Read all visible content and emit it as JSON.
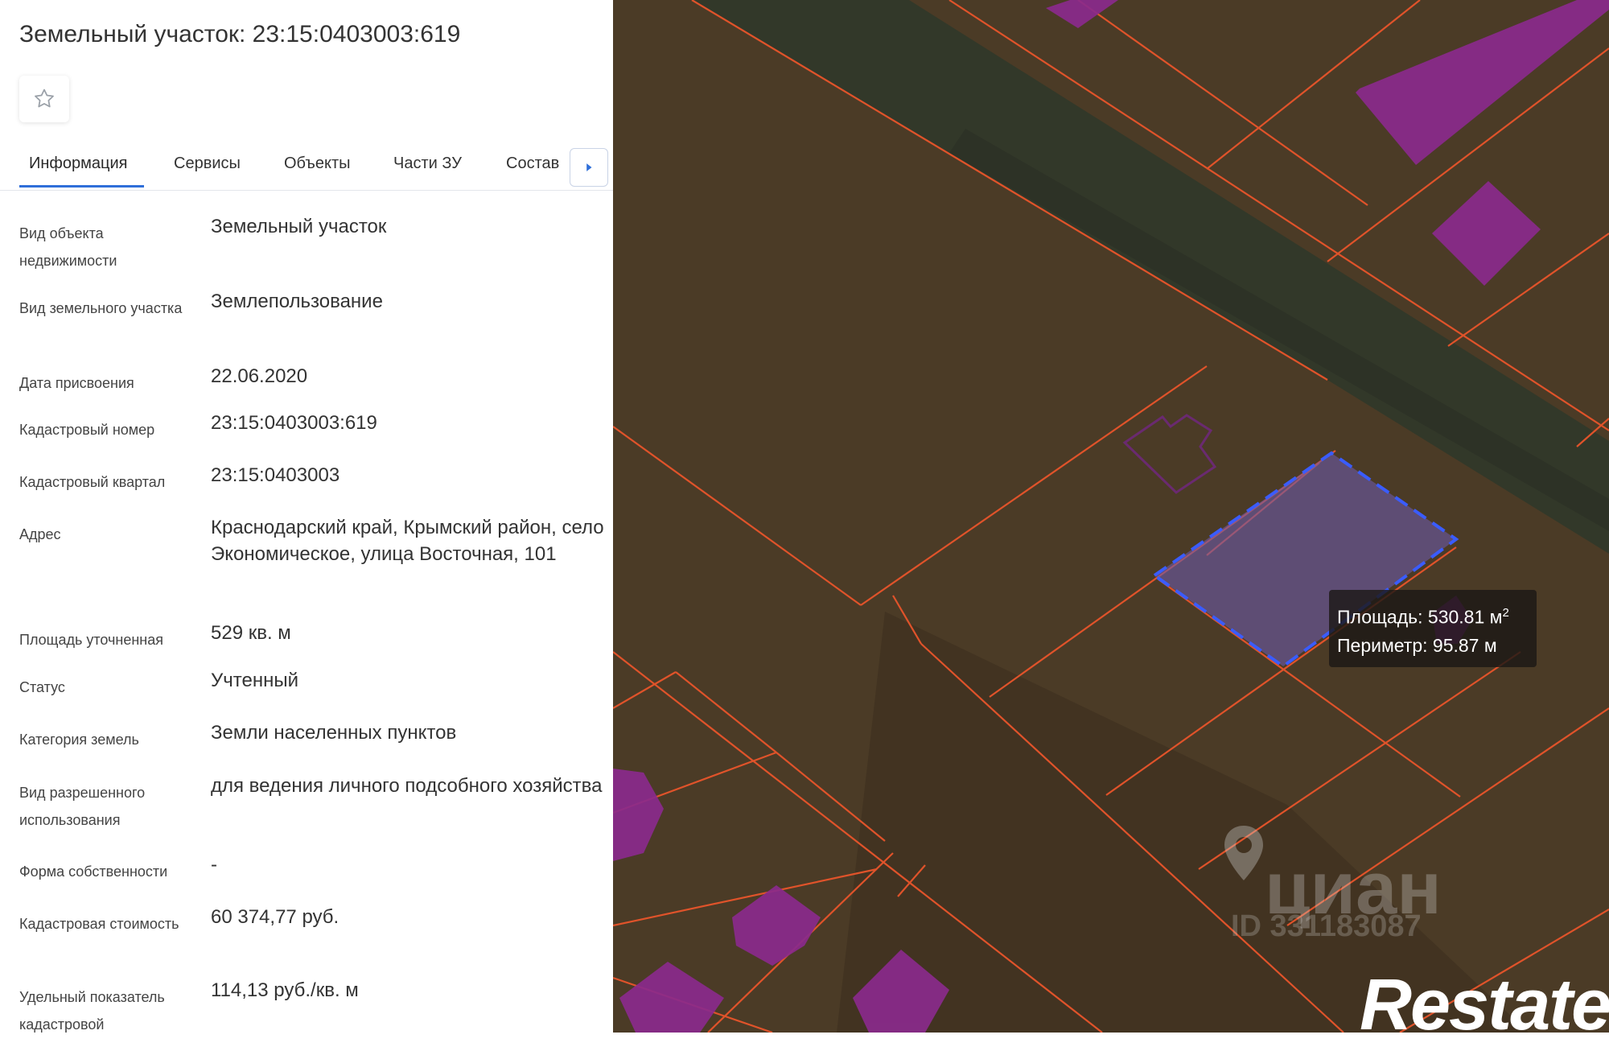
{
  "header": {
    "title": "Земельный участок: 23:15:0403003:619"
  },
  "icons": {
    "favorite": "star-outline-icon",
    "tab_scroll": "chevron-right-icon",
    "map_watermark": "pin-icon"
  },
  "tabs": [
    {
      "label": "Информация",
      "active": true
    },
    {
      "label": "Сервисы",
      "active": false
    },
    {
      "label": "Объекты",
      "active": false
    },
    {
      "label": "Части ЗУ",
      "active": false
    },
    {
      "label": "Состав",
      "active": false
    }
  ],
  "info": [
    {
      "label": "Вид объекта недвижимости",
      "value": "Земельный участок"
    },
    {
      "label": "Вид земельного участка",
      "value": "Землепользование"
    },
    {
      "label": "Дата присвоения",
      "value": "22.06.2020"
    },
    {
      "label": "Кадастровый номер",
      "value": "23:15:0403003:619"
    },
    {
      "label": "Кадастровый квартал",
      "value": "23:15:0403003"
    },
    {
      "label": "Адрес",
      "value": "Краснодарский край, Крымский район, село Экономическое, улица Восточная, 101"
    },
    {
      "label": "Площадь уточненная",
      "value": "529 кв. м"
    },
    {
      "label": "Статус",
      "value": "Учтенный"
    },
    {
      "label": "Категория земель",
      "value": "Земли населенных пунктов"
    },
    {
      "label": "Вид разрешенного использования",
      "value": "для ведения личного подсобного хозяйства"
    },
    {
      "label": "Форма собственности",
      "value": "-"
    },
    {
      "label": "Кадастровая стоимость",
      "value": "60 374,77 руб."
    },
    {
      "label": "Удельный показатель кадастровой",
      "value": "114,13 руб./кв. м"
    }
  ],
  "map": {
    "tooltip": {
      "area": "Площадь: 530.81 м",
      "area_sup": "2",
      "perimeter": "Периметр: 95.87 м"
    },
    "watermark": {
      "brand": "циан",
      "id": "ID 331183087",
      "logo": "Restate"
    }
  },
  "colors": {
    "accent": "#2f6fd9",
    "parcel_border": "#e0532a",
    "building_fill": "#8a2a8c",
    "selection_outline": "#3a5cff",
    "selection_fill": "#6a5aa8"
  }
}
